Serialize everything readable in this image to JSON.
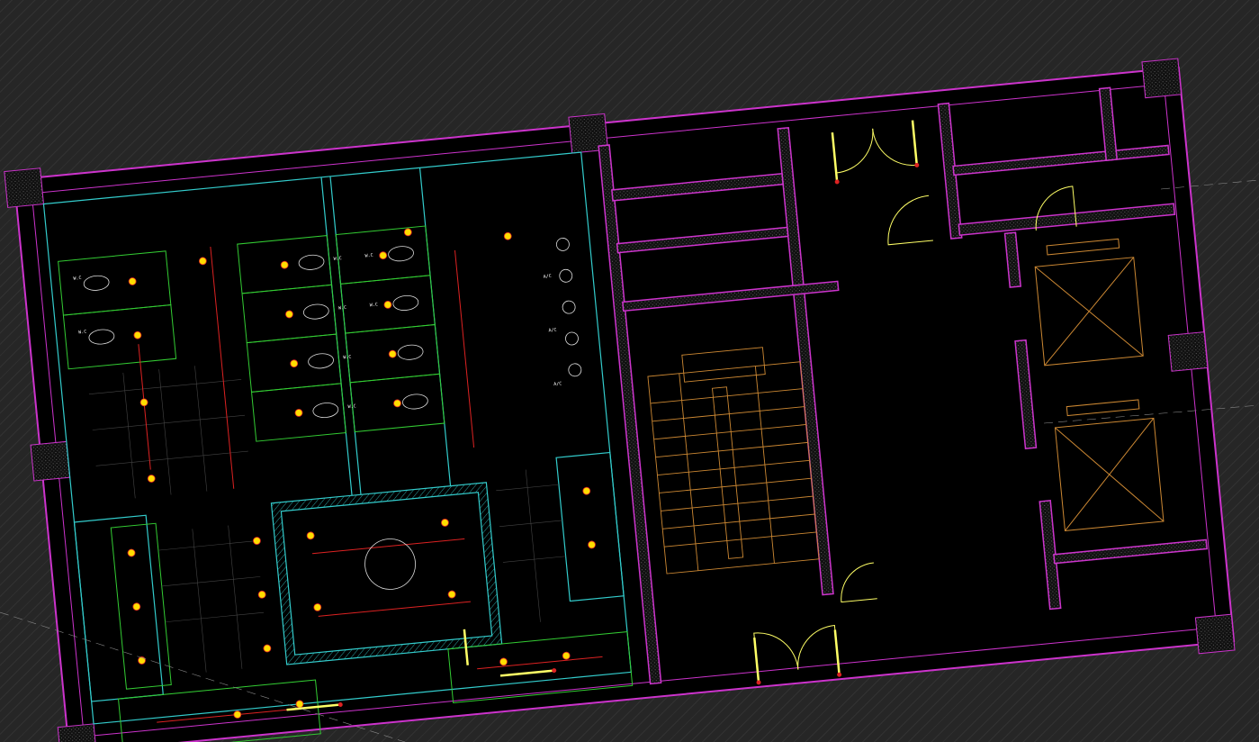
{
  "drawing": {
    "background_color": "#000000",
    "layer_colors": {
      "wall": "#cc33cc",
      "partition": "#33cccc",
      "cubicle": "#33cc33",
      "stair": "#cc8833",
      "door": "#ffff66",
      "pipe": "#dd2222",
      "fixture": "#ffdd00",
      "tile_grid": "#444444",
      "dim": "#888888"
    },
    "tags": {
      "fixture_label": "W.C",
      "panel_label": "A/C"
    }
  }
}
